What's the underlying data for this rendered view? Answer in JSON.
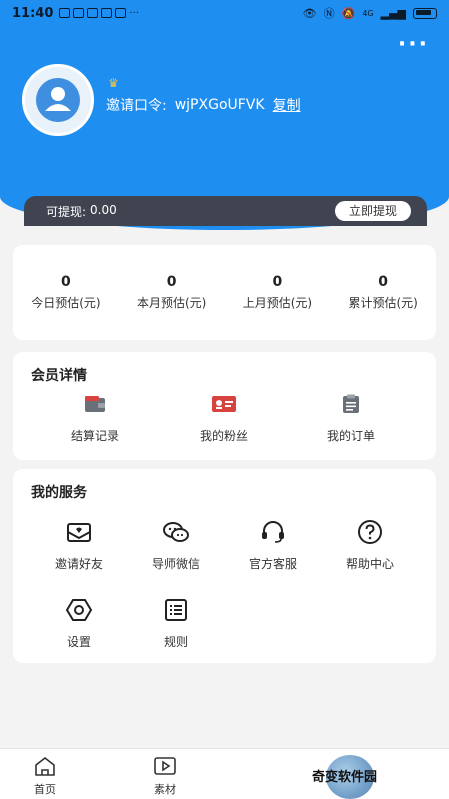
{
  "status_bar": {
    "time": "11:40",
    "network": "4G",
    "extra": "···"
  },
  "header": {
    "invite_label": "邀请口令:",
    "invite_code": "wjPXGoUFVK",
    "copy_label": "复制",
    "withdrawable_label": "可提现:",
    "withdrawable_amount": "0.00",
    "withdraw_button": "立即提现"
  },
  "earnings": [
    {
      "value": "0",
      "label": "今日预估(元)"
    },
    {
      "value": "0",
      "label": "本月预估(元)"
    },
    {
      "value": "0",
      "label": "上月预估(元)"
    },
    {
      "value": "0",
      "label": "累计预估(元)"
    }
  ],
  "member": {
    "title": "会员详情",
    "items": [
      {
        "label": "结算记录",
        "icon": "wallet-icon"
      },
      {
        "label": "我的粉丝",
        "icon": "id-card-icon"
      },
      {
        "label": "我的订单",
        "icon": "clipboard-icon"
      }
    ]
  },
  "services": {
    "title": "我的服务",
    "items": [
      {
        "label": "邀请好友",
        "icon": "envelope-icon"
      },
      {
        "label": "导师微信",
        "icon": "wechat-icon"
      },
      {
        "label": "官方客服",
        "icon": "headset-icon"
      },
      {
        "label": "帮助中心",
        "icon": "question-icon"
      },
      {
        "label": "设置",
        "icon": "hexagon-settings-icon"
      },
      {
        "label": "规则",
        "icon": "list-icon"
      }
    ]
  },
  "tabbar": [
    {
      "label": "首页",
      "icon": "home-icon"
    },
    {
      "label": "素材",
      "icon": "play-icon"
    }
  ],
  "watermark": "奇变软件园",
  "colors": {
    "primary": "#1f8ef1",
    "bar": "#3f4450",
    "accent_red": "#d9433f",
    "crown": "#f5c542"
  }
}
